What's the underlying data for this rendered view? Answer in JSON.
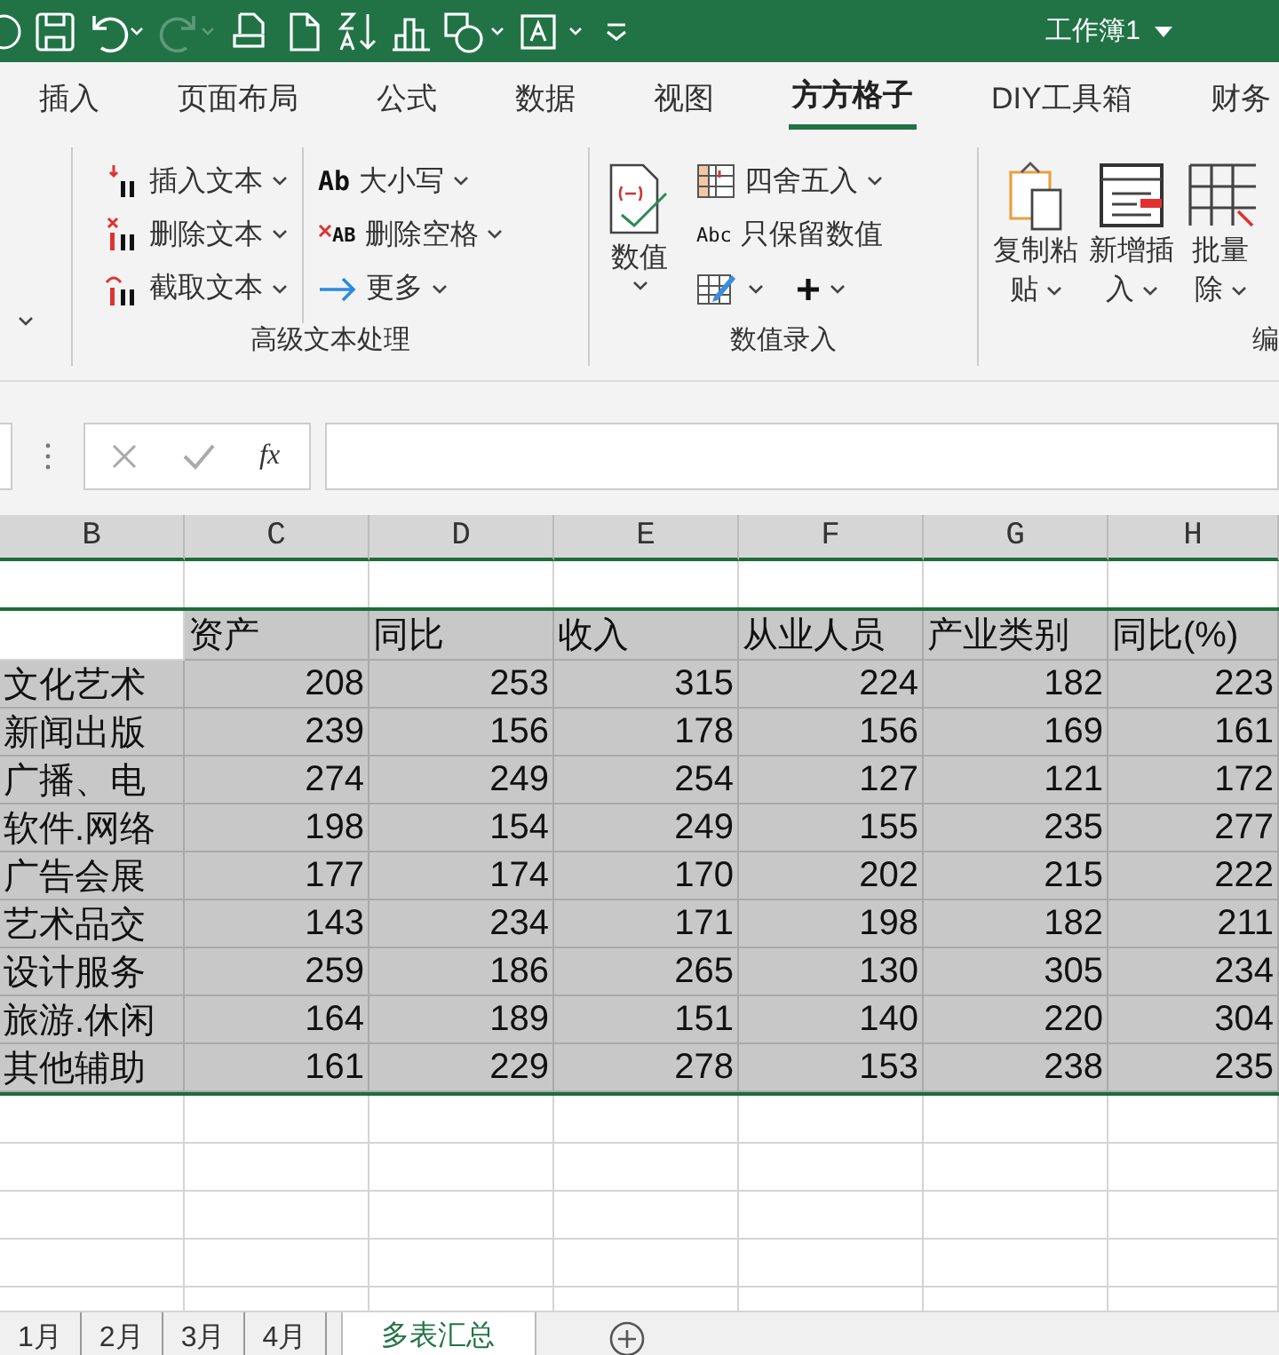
{
  "title_bar": {
    "workbook": "工作簿1"
  },
  "ribbon_tabs": [
    {
      "label": "插入",
      "selected": false
    },
    {
      "label": "页面布局",
      "selected": false
    },
    {
      "label": "公式",
      "selected": false
    },
    {
      "label": "数据",
      "selected": false
    },
    {
      "label": "视图",
      "selected": false
    },
    {
      "label": "方方格子",
      "selected": true
    },
    {
      "label": "DIY工具箱",
      "selected": false
    },
    {
      "label": "财务",
      "selected": false
    }
  ],
  "ribbon": {
    "text_group": {
      "label": "高级文本处理",
      "items": [
        {
          "kind": "insert",
          "label": "插入文本"
        },
        {
          "kind": "delete",
          "label": "删除文本"
        },
        {
          "kind": "extract",
          "label": "截取文本"
        },
        {
          "kind": "case",
          "icon_text": "Ab",
          "label": "大小写"
        },
        {
          "kind": "space",
          "icon_text": "AB",
          "label": "删除空格"
        },
        {
          "kind": "more",
          "label": "更多"
        }
      ]
    },
    "number_group": {
      "label": "数值录入",
      "big_button": "数值",
      "items": [
        {
          "kind": "round",
          "label": "四舍五入"
        },
        {
          "kind": "keep",
          "icon_text": "Abc",
          "label": "只保留数值"
        }
      ],
      "small_buttons": [
        {
          "kind": "edit"
        },
        {
          "kind": "plus"
        }
      ]
    },
    "edit_group": {
      "label": "编",
      "buttons": [
        {
          "kind": "paste",
          "lines": [
            "复制粘",
            "贴"
          ]
        },
        {
          "kind": "insert",
          "lines": [
            "新增插",
            "入"
          ]
        },
        {
          "kind": "delete",
          "lines": [
            "批量",
            "除"
          ]
        }
      ]
    }
  },
  "formula_bar": {
    "function_label": "fx"
  },
  "columns": [
    "B",
    "C",
    "D",
    "E",
    "F",
    "G",
    "H"
  ],
  "table": {
    "header": {
      "selected": true,
      "cells": [
        "资产",
        "同比",
        "收入",
        "从业人员",
        "产业类别",
        "同比(%)"
      ]
    },
    "rows": [
      {
        "selected": true,
        "cells": [
          "文化艺术",
          "208",
          "253",
          "315",
          "224",
          "182",
          "223"
        ]
      },
      {
        "selected": true,
        "cells": [
          "新闻出版",
          "239",
          "156",
          "178",
          "156",
          "169",
          "161"
        ]
      },
      {
        "selected": true,
        "cells": [
          "广播、电",
          "274",
          "249",
          "254",
          "127",
          "121",
          "172"
        ]
      },
      {
        "selected": true,
        "cells": [
          "软件.网络",
          "198",
          "154",
          "249",
          "155",
          "235",
          "277"
        ]
      },
      {
        "selected": true,
        "cells": [
          "广告会展",
          "177",
          "174",
          "170",
          "202",
          "215",
          "222"
        ]
      },
      {
        "selected": true,
        "cells": [
          "艺术品交",
          "143",
          "234",
          "171",
          "198",
          "182",
          "211"
        ]
      },
      {
        "selected": true,
        "cells": [
          "设计服务",
          "259",
          "186",
          "265",
          "130",
          "305",
          "234"
        ]
      },
      {
        "selected": true,
        "cells": [
          "旅游.休闲",
          "164",
          "189",
          "151",
          "140",
          "220",
          "304"
        ]
      },
      {
        "selected": true,
        "cells": [
          "其他辅助",
          "161",
          "229",
          "278",
          "153",
          "238",
          "235"
        ]
      }
    ]
  },
  "sheet_tabs": [
    {
      "label": "1月",
      "selected": false
    },
    {
      "label": "2月",
      "selected": false
    },
    {
      "label": "3月",
      "selected": false
    },
    {
      "label": "4月",
      "selected": false
    },
    {
      "label": "多表汇总",
      "selected": true
    }
  ]
}
